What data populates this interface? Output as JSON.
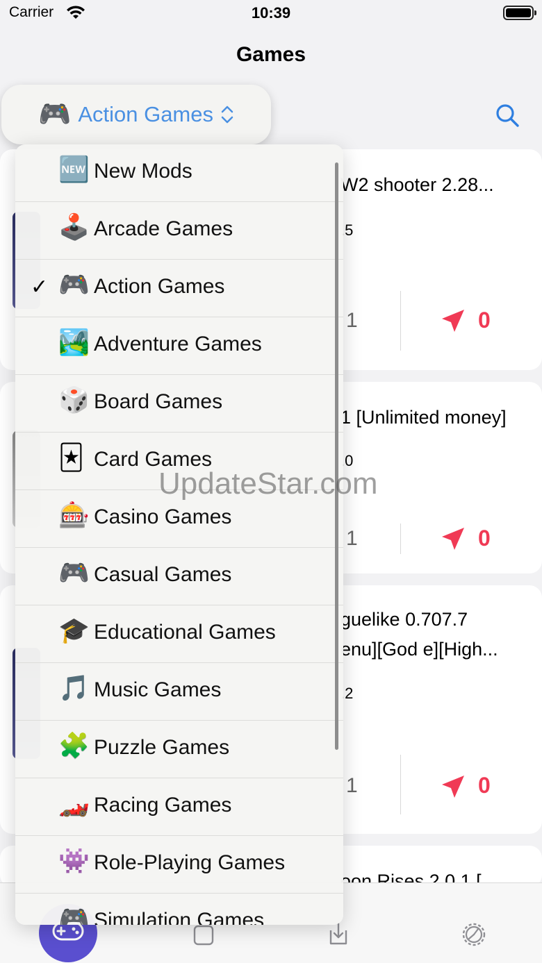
{
  "status_bar": {
    "carrier": "Carrier",
    "time": "10:39"
  },
  "nav": {
    "title": "Games"
  },
  "category_picker": {
    "emoji": "🎮",
    "label": "Action Games"
  },
  "menu": {
    "selected": "Action Games",
    "items": [
      {
        "emoji": "🆕",
        "label": "New Mods",
        "checked": false
      },
      {
        "emoji": "🕹️",
        "label": "Arcade Games",
        "checked": false
      },
      {
        "emoji": "🎮",
        "label": "Action Games",
        "checked": true
      },
      {
        "emoji": "🏞️",
        "label": "Adventure Games",
        "checked": false
      },
      {
        "emoji": "🎲",
        "label": "Board Games",
        "checked": false
      },
      {
        "emoji": "🃏",
        "label": "Card Games",
        "checked": false
      },
      {
        "emoji": "🎰",
        "label": "Casino Games",
        "checked": false
      },
      {
        "emoji": "🎮",
        "label": "Casual Games",
        "checked": false
      },
      {
        "emoji": "🎓",
        "label": "Educational Games",
        "checked": false
      },
      {
        "emoji": "🎵",
        "label": "Music Games",
        "checked": false
      },
      {
        "emoji": "🧩",
        "label": "Puzzle Games",
        "checked": false
      },
      {
        "emoji": "🏎️",
        "label": "Racing Games",
        "checked": false
      },
      {
        "emoji": "👾",
        "label": "Role-Playing Games",
        "checked": false
      },
      {
        "emoji": "🎮",
        "label": "Simulation Games",
        "checked": false
      }
    ],
    "checkmark": "✓"
  },
  "cards": [
    {
      "title": "W2 shooter 2.28...",
      "version": ".5",
      "stat": "1",
      "shares": "0"
    },
    {
      "title": "1 [Unlimited money]",
      "version": ".0",
      "stat": "1",
      "shares": "0"
    },
    {
      "title": "guelike 0.707.7",
      "subtitle": "enu][God e][High...",
      "version": ".2",
      "stat": "1",
      "shares": "0"
    },
    {
      "title": "oon Rises 2.0.1 ["
    }
  ],
  "watermark": "UpdateStar.com",
  "colors": {
    "accent": "#4a90e2",
    "share": "#f03a55",
    "tab_active": "#5a4fcf"
  },
  "tabs": [
    {
      "name": "games",
      "icon": "gamepad-icon",
      "active": true
    },
    {
      "name": "library",
      "icon": "square-icon",
      "active": false
    },
    {
      "name": "downloads",
      "icon": "download-icon",
      "active": false
    },
    {
      "name": "settings",
      "icon": "gear-icon",
      "active": false
    }
  ]
}
